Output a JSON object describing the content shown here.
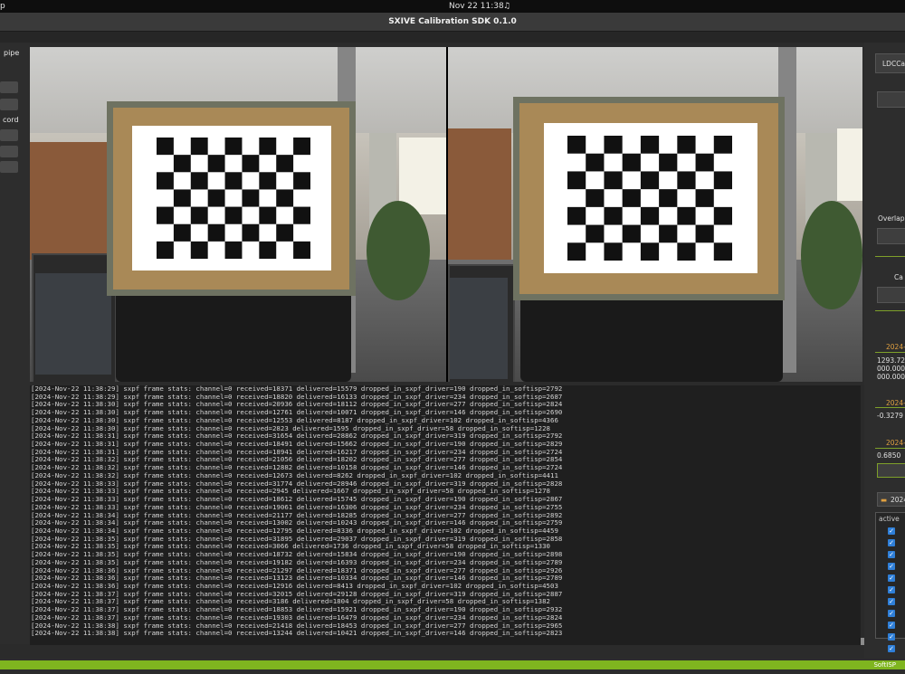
{
  "system_bar": {
    "app_name": "p",
    "clock": "Nov 22  11:38",
    "bell_icon": "bell-icon"
  },
  "window": {
    "title": "SXIVE Calibration SDK 0.1.0"
  },
  "left_panel": {
    "pipe_label": "pipe",
    "record_label": "cord"
  },
  "right_panel": {
    "ldc_label": "LDCCa",
    "overlap_label": "Overlap",
    "ca_label": "Ca",
    "section1_date": "2024-",
    "matrix_values": [
      "1293.72",
      "000.000",
      "000.000"
    ],
    "section2_date": "2024-",
    "section2_value": "-0.3279",
    "section3_date": "2024-",
    "section3_value": "0.6850",
    "folder_label": "2024",
    "folder_icon": "folder-icon",
    "active_header": "active",
    "checkbox_icon": "checkbox-checked-icon"
  },
  "status_bar": {
    "label": "SoftISP"
  },
  "log": {
    "lines": [
      "[2024-Nov-22 11:38:29] sxpf frame stats: channel=0 received=18371 delivered=15579 dropped_in_sxpf_driver=190 dropped_in_softisp=2792",
      "[2024-Nov-22 11:38:29] sxpf frame stats: channel=0 received=18820 delivered=16133 dropped_in_sxpf_driver=234 dropped_in_softisp=2687",
      "[2024-Nov-22 11:38:30] sxpf frame stats: channel=0 received=20936 delivered=18112 dropped_in_sxpf_driver=277 dropped_in_softisp=2824",
      "[2024-Nov-22 11:38:30] sxpf frame stats: channel=0 received=12761 delivered=10071 dropped_in_sxpf_driver=146 dropped_in_softisp=2690",
      "[2024-Nov-22 11:38:30] sxpf frame stats: channel=0 received=12553 delivered=8187 dropped_in_sxpf_driver=102 dropped_in_softisp=4366",
      "[2024-Nov-22 11:38:30] sxpf frame stats: channel=0 received=2823 delivered=1595 dropped_in_sxpf_driver=58 dropped_in_softisp=1228",
      "[2024-Nov-22 11:38:31] sxpf frame stats: channel=0 received=31654 delivered=28862 dropped_in_sxpf_driver=319 dropped_in_softisp=2792",
      "[2024-Nov-22 11:38:31] sxpf frame stats: channel=0 received=18491 delivered=15662 dropped_in_sxpf_driver=190 dropped_in_softisp=2829",
      "[2024-Nov-22 11:38:31] sxpf frame stats: channel=0 received=18941 delivered=16217 dropped_in_sxpf_driver=234 dropped_in_softisp=2724",
      "[2024-Nov-22 11:38:32] sxpf frame stats: channel=0 received=21056 delivered=18202 dropped_in_sxpf_driver=277 dropped_in_softisp=2854",
      "[2024-Nov-22 11:38:32] sxpf frame stats: channel=0 received=12882 delivered=10158 dropped_in_sxpf_driver=146 dropped_in_softisp=2724",
      "[2024-Nov-22 11:38:32] sxpf frame stats: channel=0 received=12673 delivered=8262 dropped_in_sxpf_driver=102 dropped_in_softisp=4411",
      "[2024-Nov-22 11:38:33] sxpf frame stats: channel=0 received=31774 delivered=28946 dropped_in_sxpf_driver=319 dropped_in_softisp=2828",
      "[2024-Nov-22 11:38:33] sxpf frame stats: channel=0 received=2945 delivered=1667 dropped_in_sxpf_driver=58 dropped_in_softisp=1278",
      "[2024-Nov-22 11:38:33] sxpf frame stats: channel=0 received=18612 delivered=15745 dropped_in_sxpf_driver=190 dropped_in_softisp=2867",
      "[2024-Nov-22 11:38:33] sxpf frame stats: channel=0 received=19061 delivered=16306 dropped_in_sxpf_driver=234 dropped_in_softisp=2755",
      "[2024-Nov-22 11:38:34] sxpf frame stats: channel=0 received=21177 delivered=18285 dropped_in_sxpf_driver=277 dropped_in_softisp=2892",
      "[2024-Nov-22 11:38:34] sxpf frame stats: channel=0 received=13002 delivered=10243 dropped_in_sxpf_driver=146 dropped_in_softisp=2759",
      "[2024-Nov-22 11:38:34] sxpf frame stats: channel=0 received=12795 delivered=8336 dropped_in_sxpf_driver=102 dropped_in_softisp=4459",
      "[2024-Nov-22 11:38:35] sxpf frame stats: channel=0 received=31895 delivered=29037 dropped_in_sxpf_driver=319 dropped_in_softisp=2858",
      "[2024-Nov-22 11:38:35] sxpf frame stats: channel=0 received=3066 delivered=1736 dropped_in_sxpf_driver=58 dropped_in_softisp=1330",
      "[2024-Nov-22 11:38:35] sxpf frame stats: channel=0 received=18732 delivered=15834 dropped_in_sxpf_driver=190 dropped_in_softisp=2898",
      "[2024-Nov-22 11:38:35] sxpf frame stats: channel=0 received=19182 delivered=16393 dropped_in_sxpf_driver=234 dropped_in_softisp=2789",
      "[2024-Nov-22 11:38:36] sxpf frame stats: channel=0 received=21297 delivered=18371 dropped_in_sxpf_driver=277 dropped_in_softisp=2926",
      "[2024-Nov-22 11:38:36] sxpf frame stats: channel=0 received=13123 delivered=10334 dropped_in_sxpf_driver=146 dropped_in_softisp=2789",
      "[2024-Nov-22 11:38:36] sxpf frame stats: channel=0 received=12916 delivered=8413 dropped_in_sxpf_driver=102 dropped_in_softisp=4503",
      "[2024-Nov-22 11:38:37] sxpf frame stats: channel=0 received=32015 delivered=29128 dropped_in_sxpf_driver=319 dropped_in_softisp=2887",
      "[2024-Nov-22 11:38:37] sxpf frame stats: channel=0 received=3186 delivered=1804 dropped_in_sxpf_driver=58 dropped_in_softisp=1382",
      "[2024-Nov-22 11:38:37] sxpf frame stats: channel=0 received=18853 delivered=15921 dropped_in_sxpf_driver=190 dropped_in_softisp=2932",
      "[2024-Nov-22 11:38:37] sxpf frame stats: channel=0 received=19303 delivered=16479 dropped_in_sxpf_driver=234 dropped_in_softisp=2824",
      "[2024-Nov-22 11:38:38] sxpf frame stats: channel=0 received=21418 delivered=18453 dropped_in_sxpf_driver=277 dropped_in_softisp=2965",
      "[2024-Nov-22 11:38:38] sxpf frame stats: channel=0 received=13244 delivered=10421 dropped_in_sxpf_driver=146 dropped_in_softisp=2823"
    ]
  }
}
